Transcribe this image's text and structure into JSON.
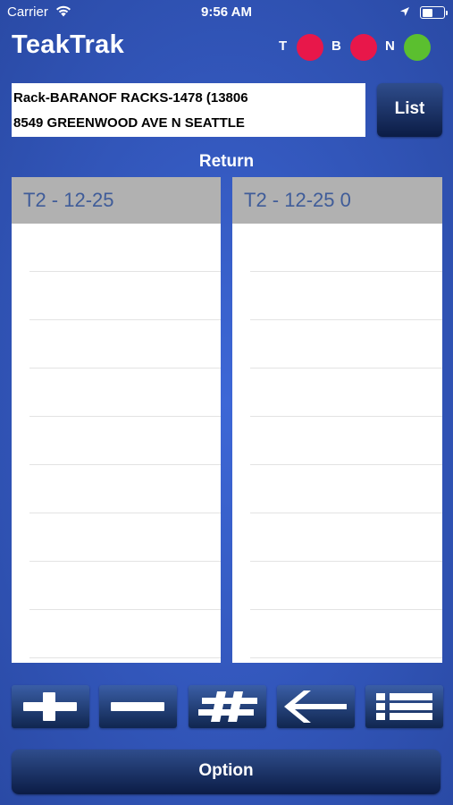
{
  "status_bar": {
    "carrier": "Carrier",
    "time": "9:56 AM"
  },
  "app": {
    "title": "TeakTrak"
  },
  "indicators": [
    {
      "label": "T",
      "color": "#e8174a"
    },
    {
      "label": "B",
      "color": "#e8174a"
    },
    {
      "label": "N",
      "color": "#5bbf2f"
    }
  ],
  "location": {
    "line1": "Rack-BARANOF RACKS-1478 (13806",
    "line2": "8549 GREENWOOD AVE N SEATTLE"
  },
  "list_button": {
    "label": "List"
  },
  "section": {
    "title": "Return"
  },
  "left_panel": {
    "header": "T2 - 12-25"
  },
  "right_panel": {
    "header": "T2 - 12-25 0"
  },
  "toolbar": {
    "buttons": [
      {
        "icon": "plus-icon"
      },
      {
        "icon": "minus-icon"
      },
      {
        "icon": "hash-icon"
      },
      {
        "icon": "arrow-left-icon"
      },
      {
        "icon": "list-icon"
      }
    ]
  },
  "option_button": {
    "label": "Option"
  }
}
